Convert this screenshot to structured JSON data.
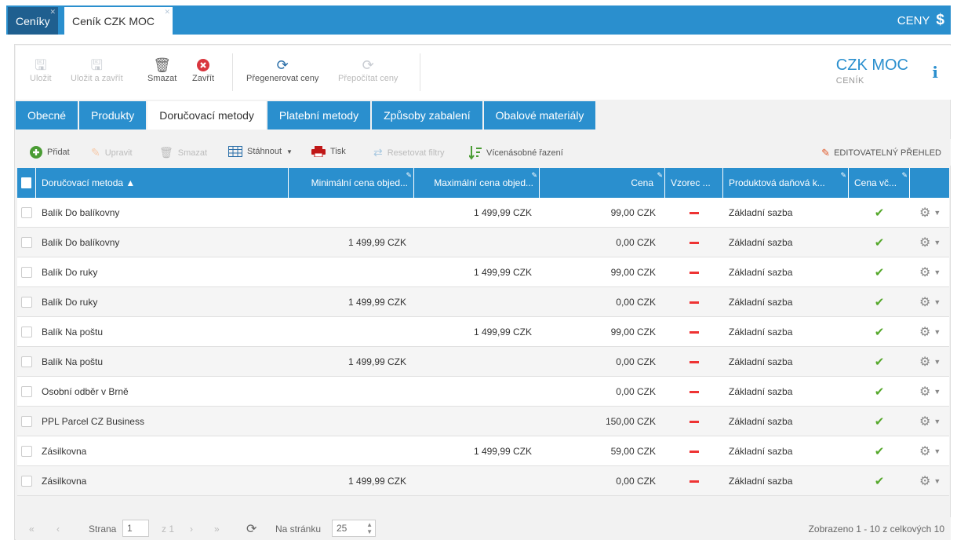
{
  "topbar": {
    "tabs": [
      "Ceníky",
      "Ceník CZK MOC"
    ],
    "section": "CENY",
    "section_icon": "$"
  },
  "toolbar": {
    "save": "Uložit",
    "save_close": "Uložit a zavřít",
    "delete": "Smazat",
    "close": "Zavřít",
    "regenerate": "Přegenerovat ceny",
    "recalculate": "Přepočítat ceny",
    "title": "CZK MOC",
    "subtitle": "CENÍK"
  },
  "subtabs": [
    "Obecné",
    "Produkty",
    "Doručovací metody",
    "Platební metody",
    "Způsoby zabalení",
    "Obalové materiály"
  ],
  "gridbar": {
    "add": "Přidat",
    "edit": "Upravit",
    "delete": "Smazat",
    "download": "Stáhnout",
    "print": "Tisk",
    "reset_filters": "Resetovat filtry",
    "multi_sort": "Vícenásobné řazení",
    "editable_view": "EDITOVATELNÝ PŘEHLED"
  },
  "columns": [
    "Doručovací metoda ▲",
    "Minimální cena objed...",
    "Maximální cena objed...",
    "Cena",
    "Vzorec ...",
    "Produktová daňová k...",
    "Cena vč..."
  ],
  "rows": [
    {
      "name": "Balík Do balíkovny",
      "min": "",
      "max": "1 499,99 CZK",
      "price": "99,00 CZK",
      "tax": "Základní sazba"
    },
    {
      "name": "Balík Do balíkovny",
      "min": "1 499,99 CZK",
      "max": "",
      "price": "0,00 CZK",
      "tax": "Základní sazba"
    },
    {
      "name": "Balík Do ruky",
      "min": "",
      "max": "1 499,99 CZK",
      "price": "99,00 CZK",
      "tax": "Základní sazba"
    },
    {
      "name": "Balík Do ruky",
      "min": "1 499,99 CZK",
      "max": "",
      "price": "0,00 CZK",
      "tax": "Základní sazba"
    },
    {
      "name": "Balík Na poštu",
      "min": "",
      "max": "1 499,99 CZK",
      "price": "99,00 CZK",
      "tax": "Základní sazba"
    },
    {
      "name": "Balík Na poštu",
      "min": "1 499,99 CZK",
      "max": "",
      "price": "0,00 CZK",
      "tax": "Základní sazba"
    },
    {
      "name": "Osobní odběr v Brně",
      "min": "",
      "max": "",
      "price": "0,00 CZK",
      "tax": "Základní sazba"
    },
    {
      "name": "PPL Parcel CZ Business",
      "min": "",
      "max": "",
      "price": "150,00 CZK",
      "tax": "Základní sazba"
    },
    {
      "name": "Zásilkovna",
      "min": "",
      "max": "1 499,99 CZK",
      "price": "59,00 CZK",
      "tax": "Základní sazba"
    },
    {
      "name": "Zásilkovna",
      "min": "1 499,99 CZK",
      "max": "",
      "price": "0,00 CZK",
      "tax": "Základní sazba"
    }
  ],
  "pager": {
    "page_label": "Strana",
    "page": "1",
    "of": "z 1",
    "per_page_label": "Na stránku",
    "per_page": "25",
    "info": "Zobrazeno 1 - 10 z celkových 10"
  }
}
